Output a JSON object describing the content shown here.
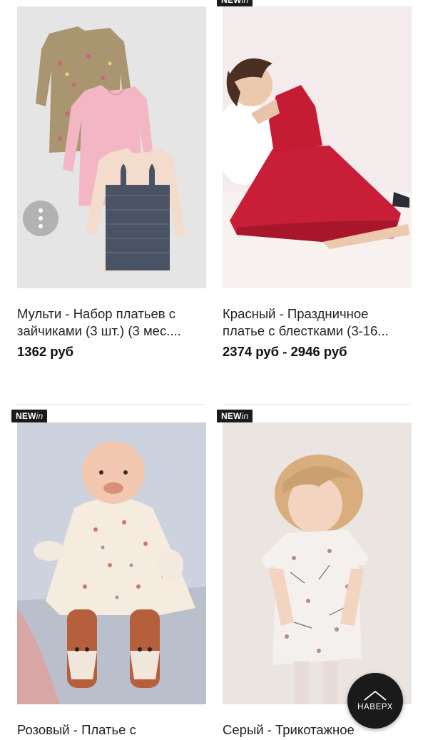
{
  "badge": {
    "new": "NEW",
    "in": "in"
  },
  "products": [
    {
      "title_line1": "Мульти - Набор платьев с",
      "title_line2": "зайчиками (3 шт.) (3 мес....",
      "price": "1362 руб",
      "is_new": false
    },
    {
      "title_line1": "Красный - Праздничное",
      "title_line2": "платье с блестками (3-16...",
      "price": "2374 руб - 2946 руб",
      "is_new": true
    },
    {
      "title_line1": "Розовый - Платье с",
      "title_line2": "",
      "price": "",
      "is_new": true
    },
    {
      "title_line1": "Серый - Трикотажное",
      "title_line2": "",
      "price": "",
      "is_new": true
    }
  ],
  "back_to_top": {
    "label": "НАВЕРХ",
    "icon": "chevron-up-icon"
  },
  "more_options": {
    "icon": "more-vertical-icon"
  },
  "colors": {
    "badge_bg": "#1b1b1b",
    "divider": "#e6e6e6",
    "button_dark": "#1a1a1a"
  }
}
